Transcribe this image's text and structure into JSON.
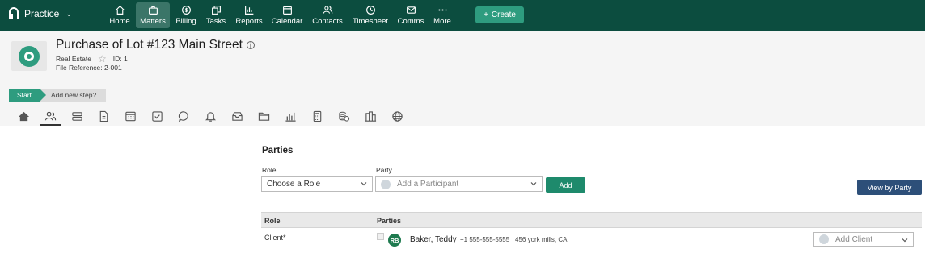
{
  "nav": {
    "brand": "Practice",
    "items": [
      {
        "label": "Home",
        "icon": "home-icon"
      },
      {
        "label": "Matters",
        "icon": "briefcase-icon"
      },
      {
        "label": "Billing",
        "icon": "dollar-icon"
      },
      {
        "label": "Tasks",
        "icon": "tasks-icon"
      },
      {
        "label": "Reports",
        "icon": "reports-icon"
      },
      {
        "label": "Calendar",
        "icon": "calendar-icon"
      },
      {
        "label": "Contacts",
        "icon": "contacts-icon"
      },
      {
        "label": "Timesheet",
        "icon": "clock-icon"
      },
      {
        "label": "Comms",
        "icon": "mail-icon"
      },
      {
        "label": "More",
        "icon": "ellipsis-icon"
      }
    ],
    "active": "Matters",
    "create_label": "Create"
  },
  "matter": {
    "title": "Purchase of Lot #123 Main Street",
    "type": "Real Estate",
    "id_label": "ID: 1",
    "file_reference": "File Reference: 2-001"
  },
  "steps": {
    "start_label": "Start",
    "add_label": "Add new step?"
  },
  "tabs": [
    "home-icon",
    "parties-icon",
    "details-icon",
    "document-icon",
    "calculator-grid-icon",
    "checkbox-icon",
    "chat-icon",
    "bell-icon",
    "inbox-icon",
    "folder-icon",
    "chart-icon",
    "calculator-icon",
    "coins-icon",
    "building-icon",
    "globe-icon"
  ],
  "parties": {
    "heading": "Parties",
    "role_label": "Role",
    "party_label": "Party",
    "role_select_value": "Choose a Role",
    "party_placeholder": "Add a Participant",
    "add_button": "Add",
    "view_by_party": "View by Party",
    "columns": [
      "Role",
      "Parties"
    ],
    "rows": [
      {
        "role": "Client*",
        "initials": "RB",
        "name": "Baker, Teddy",
        "phone": "+1 555-555-5555",
        "address": "456 york mills, CA",
        "add_placeholder": "Add Client"
      }
    ]
  },
  "colors": {
    "nav_bg": "#0c4d3f",
    "accent": "#2e9c7f",
    "view_button": "#2d4f79"
  }
}
